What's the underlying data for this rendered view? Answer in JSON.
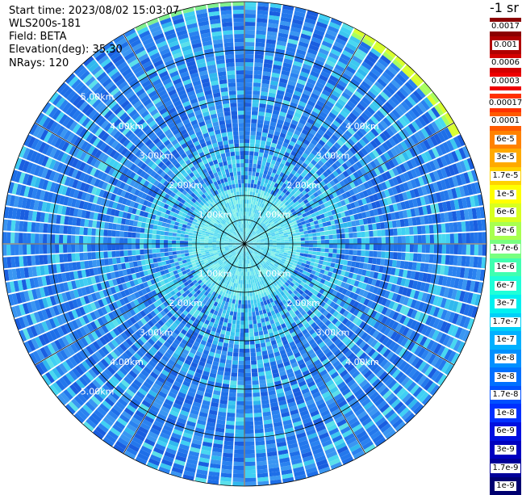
{
  "info": {
    "start_time": "Start time: 2023/08/02 15:03:07",
    "device": "WLS200s-181",
    "field": "Field: BETA",
    "elevation": "Elevation(deg): 35.30",
    "nrays": "NRays: 120"
  },
  "colorbar": {
    "title": "-1 sr",
    "levels": [
      {
        "label": "0.0017",
        "color": "#8b0000"
      },
      {
        "label": "0.001",
        "color": "#b00000"
      },
      {
        "label": "0.0006",
        "color": "#d40000"
      },
      {
        "label": "0.0003",
        "color": "#ee0000"
      },
      {
        "label": "0.00017",
        "color": "#ff3000"
      },
      {
        "label": "0.0001",
        "color": "#ff5a00"
      },
      {
        "label": "6e-5",
        "color": "#ff8200"
      },
      {
        "label": "3e-5",
        "color": "#ffaa00"
      },
      {
        "label": "1.7e-5",
        "color": "#ffd200"
      },
      {
        "label": "1e-5",
        "color": "#ffff00"
      },
      {
        "label": "6e-6",
        "color": "#d8ff20"
      },
      {
        "label": "3e-6",
        "color": "#a8ff50"
      },
      {
        "label": "1.7e-6",
        "color": "#78ff80"
      },
      {
        "label": "1e-6",
        "color": "#40ffb0"
      },
      {
        "label": "6e-7",
        "color": "#20ffd8"
      },
      {
        "label": "3e-7",
        "color": "#00f0f0"
      },
      {
        "label": "1.7e-7",
        "color": "#00d0f8"
      },
      {
        "label": "1e-7",
        "color": "#00b0ff"
      },
      {
        "label": "6e-8",
        "color": "#0090ff"
      },
      {
        "label": "3e-8",
        "color": "#0070ff"
      },
      {
        "label": "1.7e-8",
        "color": "#0050ff"
      },
      {
        "label": "1e-8",
        "color": "#0030ff"
      },
      {
        "label": "6e-9",
        "color": "#0010e0"
      },
      {
        "label": "3e-9",
        "color": "#0000c0"
      },
      {
        "label": "1.7e-9",
        "color": "#00009a"
      },
      {
        "label": "1e-9",
        "color": "#000070"
      }
    ]
  },
  "chart_data": {
    "type": "heatmap",
    "projection": "polar PPI",
    "field": "BETA",
    "n_rays": 120,
    "elevation_deg": 35.3,
    "range_rings_km": [
      1,
      2,
      3,
      4,
      5
    ],
    "range_ring_labels": [
      "1.00km",
      "2.00km",
      "3.00km",
      "4.00km",
      "5.00km"
    ],
    "max_range_km": 5.0,
    "radial_lines_deg": [
      0,
      30,
      60,
      90,
      120,
      150,
      180,
      210,
      240,
      270,
      300,
      330
    ],
    "dominant_value_range": [
      "3e-8",
      "1e-7"
    ],
    "high_value_region": "outer edge, north-east sector"
  }
}
